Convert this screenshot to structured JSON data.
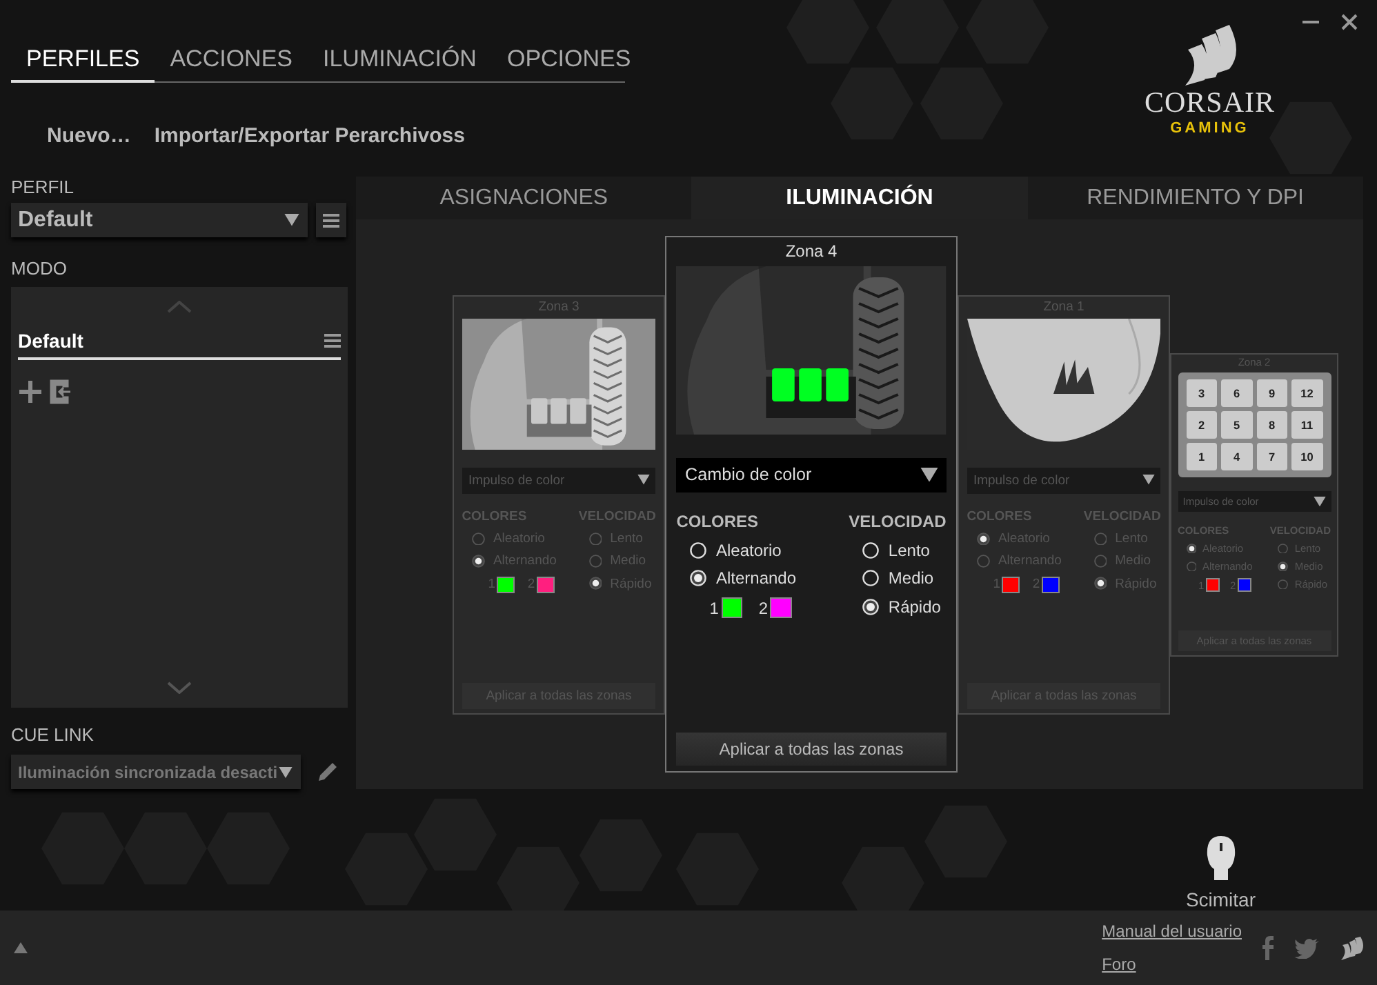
{
  "nav": {
    "tabs": [
      {
        "label": "PERFILES",
        "selected": true
      },
      {
        "label": "ACCIONES",
        "selected": false
      },
      {
        "label": "ILUMINACIÓN",
        "selected": false
      },
      {
        "label": "OPCIONES",
        "selected": false
      }
    ]
  },
  "actions": [
    "Nuevo…",
    "Importar/Exportar Perarchivoss"
  ],
  "logo": {
    "brand": "CORSAIR",
    "sub": "GAMING"
  },
  "sidebar": {
    "profile": {
      "label": "PERFIL",
      "value": "Default"
    },
    "mode": {
      "label": "MODO",
      "items": [
        {
          "label": "Default",
          "selected": true
        }
      ]
    },
    "cue_link": {
      "label": "CUE LINK",
      "value": "Iluminación sincronizada desacti"
    }
  },
  "panel": {
    "tabs": [
      {
        "label": "ASIGNACIONES",
        "selected": false
      },
      {
        "label": "ILUMINACIÓN",
        "selected": true
      },
      {
        "label": "RENDIMIENTO Y DPI",
        "selected": false
      }
    ],
    "zones": [
      {
        "title": "Zona 3",
        "selected": false,
        "kind": "side",
        "effect": "Impulso de color",
        "colors_label": "COLORES",
        "speed_label": "VELOCIDAD",
        "color_options": [
          {
            "label": "Aleatorio",
            "selected": false
          },
          {
            "label": "Alternando",
            "selected": true
          }
        ],
        "swatches": [
          {
            "label": "1",
            "color": "#00ff00"
          },
          {
            "label": "2",
            "color": "#ff1f7f"
          }
        ],
        "speed_options": [
          {
            "label": "Lento",
            "selected": false
          },
          {
            "label": "Medio",
            "selected": false
          },
          {
            "label": "Rápido",
            "selected": true
          }
        ],
        "apply": "Aplicar a todas las zonas"
      },
      {
        "title": "Zona 4",
        "selected": true,
        "kind": "side",
        "effect": "Cambio de color",
        "colors_label": "COLORES",
        "speed_label": "VELOCIDAD",
        "color_options": [
          {
            "label": "Aleatorio",
            "selected": false
          },
          {
            "label": "Alternando",
            "selected": true
          }
        ],
        "swatches": [
          {
            "label": "1",
            "color": "#00ff00"
          },
          {
            "label": "2",
            "color": "#ff00ff"
          }
        ],
        "speed_options": [
          {
            "label": "Lento",
            "selected": false
          },
          {
            "label": "Medio",
            "selected": false
          },
          {
            "label": "Rápido",
            "selected": true
          }
        ],
        "apply": "Aplicar a todas las zonas"
      },
      {
        "title": "Zona 1",
        "selected": false,
        "kind": "top",
        "effect": "Impulso de color",
        "colors_label": "COLORES",
        "speed_label": "VELOCIDAD",
        "color_options": [
          {
            "label": "Aleatorio",
            "selected": true
          },
          {
            "label": "Alternando",
            "selected": false
          }
        ],
        "swatches": [
          {
            "label": "1",
            "color": "#ff0000"
          },
          {
            "label": "2",
            "color": "#0000ff"
          }
        ],
        "speed_options": [
          {
            "label": "Lento",
            "selected": false
          },
          {
            "label": "Medio",
            "selected": false
          },
          {
            "label": "Rápido",
            "selected": true
          }
        ],
        "apply": "Aplicar a todas las zonas"
      },
      {
        "title": "Zona 2",
        "selected": false,
        "kind": "keypad",
        "keys": [
          "3",
          "6",
          "9",
          "12",
          "2",
          "5",
          "8",
          "11",
          "1",
          "4",
          "7",
          "10"
        ],
        "effect": "Impulso de color",
        "colors_label": "COLORES",
        "speed_label": "VELOCIDAD",
        "color_options": [
          {
            "label": "Aleatorio",
            "selected": true
          },
          {
            "label": "Alternando",
            "selected": false
          }
        ],
        "swatches": [
          {
            "label": "1",
            "color": "#ff0000"
          },
          {
            "label": "2",
            "color": "#0000ff"
          }
        ],
        "speed_options": [
          {
            "label": "Lento",
            "selected": false
          },
          {
            "label": "Medio",
            "selected": true
          },
          {
            "label": "Rápido",
            "selected": false
          }
        ],
        "apply": "Aplicar a todas las zonas"
      }
    ]
  },
  "device": {
    "name": "Scimitar"
  },
  "footer": {
    "links": [
      "Manual del usuario",
      "Foro"
    ]
  }
}
